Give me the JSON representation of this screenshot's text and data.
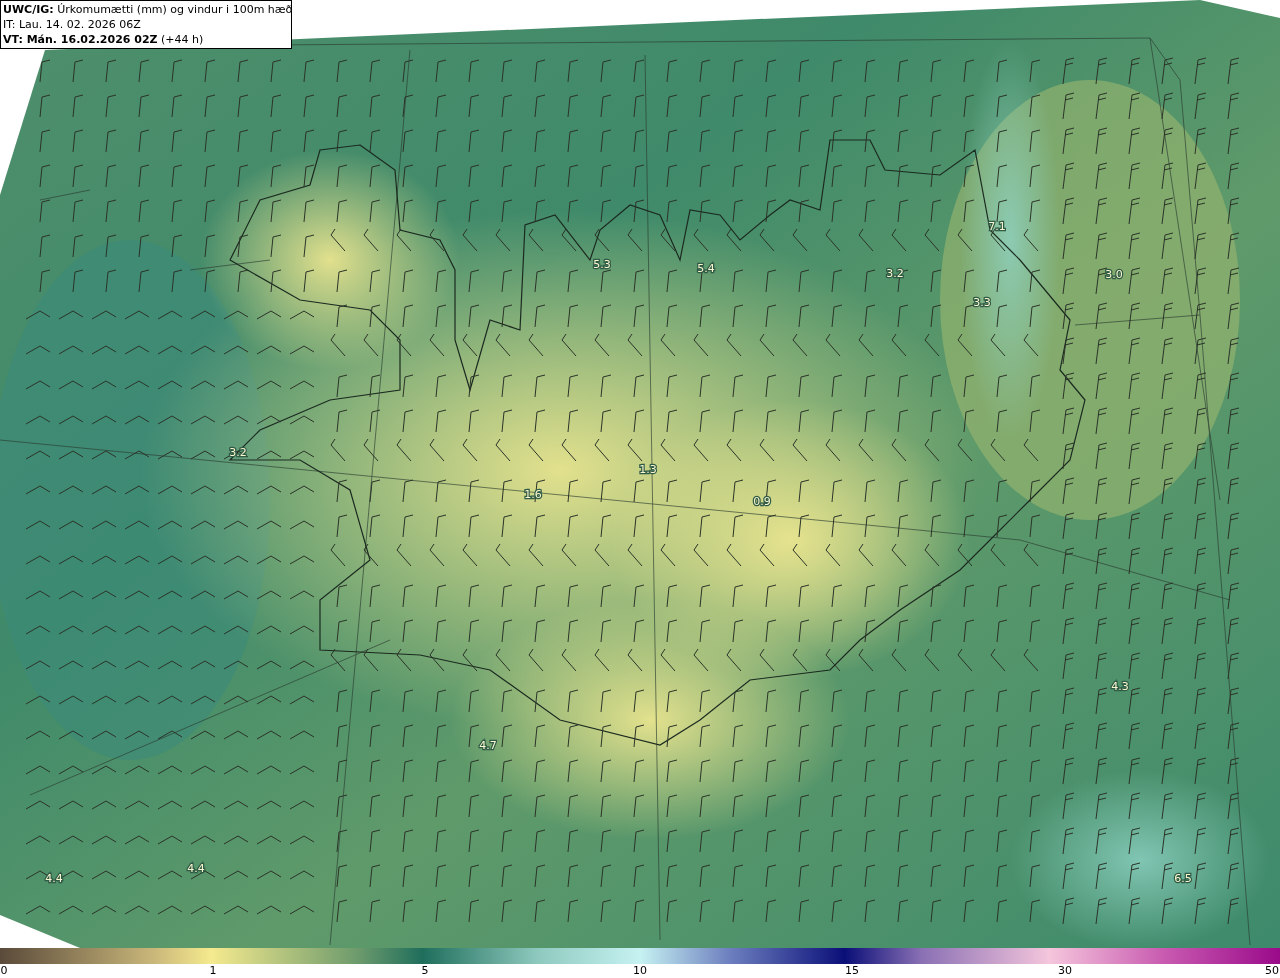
{
  "header": {
    "lines": [
      "**UWC/IG:** Úrkomumætti (mm) og vindur i 100m hæð",
      "IT: Lau. 14. 02. 2026 06Z",
      "**VT: Mán. 16.02.2026 02Z** (+44 h)"
    ]
  },
  "map": {
    "value_labels": [
      "5.3",
      "5.4",
      "3.2",
      "7.1",
      "3.0",
      "3.3",
      "3.2",
      "1.3",
      "1.6",
      "0.9",
      "4.3",
      "4.7",
      "4.4",
      "4.4",
      "6.5"
    ]
  },
  "colorbar": {
    "ticks": [
      "0",
      "1",
      "5",
      "10",
      "15",
      "30",
      "50"
    ]
  }
}
